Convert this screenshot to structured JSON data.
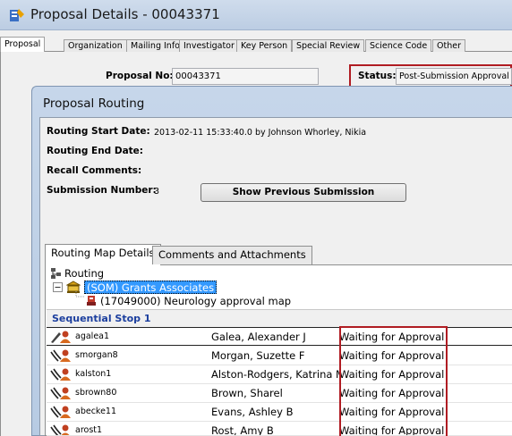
{
  "window": {
    "title": "Proposal Details - 00043371"
  },
  "tabs": [
    "Proposal",
    "Organization",
    "Mailing Info",
    "Investigator",
    "Key Person",
    "Special Review",
    "Science Code",
    "Other"
  ],
  "proposal": {
    "number_label": "Proposal No:",
    "number_value": "00043371",
    "status_label": "Status:",
    "status_value": "Post-Submission Approval"
  },
  "routing": {
    "title": "Proposal Routing",
    "start_date_label": "Routing Start Date:",
    "start_date_value": "2013-02-11 15:33:40.0 by Johnson Whorley, Nikia",
    "end_date_label": "Routing End Date:",
    "recall_label": "Recall Comments:",
    "submission_label": "Submission Number:",
    "submission_value": "3",
    "show_prev_button": "Show Previous Submission",
    "tabs": [
      "Routing Map Details",
      "Comments and Attachments"
    ],
    "tree": {
      "root": "Routing",
      "unit": "(SOM) Grants Associates",
      "map": "(17049000) Neurology approval map"
    },
    "stop_label": "Sequential Stop 1",
    "approvers": [
      {
        "user_id": "agalea1",
        "name": "Galea, Alexander J",
        "status": "Waiting for Approval"
      },
      {
        "user_id": "smorgan8",
        "name": "Morgan, Suzette F",
        "status": "Waiting for Approval"
      },
      {
        "user_id": "kalston1",
        "name": "Alston-Rodgers, Katrina M",
        "status": "Waiting for Approval"
      },
      {
        "user_id": "sbrown80",
        "name": "Brown, Sharel",
        "status": "Waiting for Approval"
      },
      {
        "user_id": "abecke11",
        "name": "Evans, Ashley B",
        "status": "Waiting for Approval"
      },
      {
        "user_id": "arost1",
        "name": "Rost, Amy B",
        "status": "Waiting for Approval"
      }
    ]
  },
  "colors": {
    "highlight_box": "#b01c22",
    "selection": "#3399ff",
    "stop_label": "#1b3e9e"
  }
}
